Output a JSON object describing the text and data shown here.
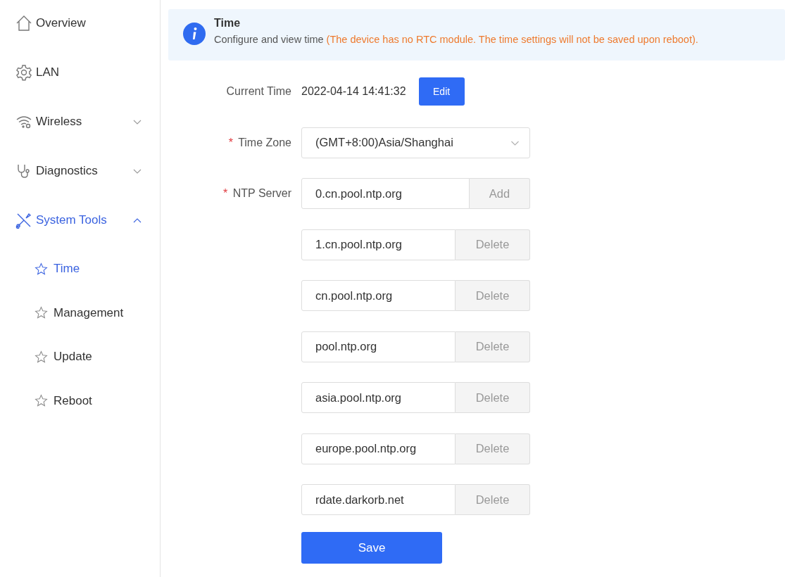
{
  "sidebar": {
    "items": [
      {
        "label": "Overview",
        "selected": false
      },
      {
        "label": "LAN",
        "selected": false
      },
      {
        "label": "Wireless",
        "selected": false,
        "expanded": false
      },
      {
        "label": "Diagnostics",
        "selected": false,
        "expanded": false
      },
      {
        "label": "System Tools",
        "selected": true,
        "expanded": true,
        "children": [
          {
            "label": "Time",
            "selected": true
          },
          {
            "label": "Management",
            "selected": false
          },
          {
            "label": "Update",
            "selected": false
          },
          {
            "label": "Reboot",
            "selected": false
          }
        ]
      }
    ]
  },
  "banner": {
    "title": "Time",
    "text": "Configure and view time",
    "warning": "(The device has no RTC module. The time settings will not be saved upon reboot)."
  },
  "current_time": {
    "label": "Current Time",
    "value": "2022-04-14 14:41:32",
    "button": "Edit"
  },
  "time_zone": {
    "label": "Time Zone",
    "required_mark": "*",
    "value": "(GMT+8:00)Asia/Shanghai"
  },
  "ntp_server": {
    "label": "NTP Server",
    "required_mark": "*",
    "servers": [
      {
        "value": "0.cn.pool.ntp.org",
        "action": "Add",
        "kind": "add"
      },
      {
        "value": "1.cn.pool.ntp.org",
        "action": "Delete",
        "kind": "delete"
      },
      {
        "value": "cn.pool.ntp.org",
        "action": "Delete",
        "kind": "delete"
      },
      {
        "value": "pool.ntp.org",
        "action": "Delete",
        "kind": "delete"
      },
      {
        "value": "asia.pool.ntp.org",
        "action": "Delete",
        "kind": "delete"
      },
      {
        "value": "europe.pool.ntp.org",
        "action": "Delete",
        "kind": "delete"
      },
      {
        "value": "rdate.darkorb.net",
        "action": "Delete",
        "kind": "delete"
      }
    ]
  },
  "save_button": "Save"
}
